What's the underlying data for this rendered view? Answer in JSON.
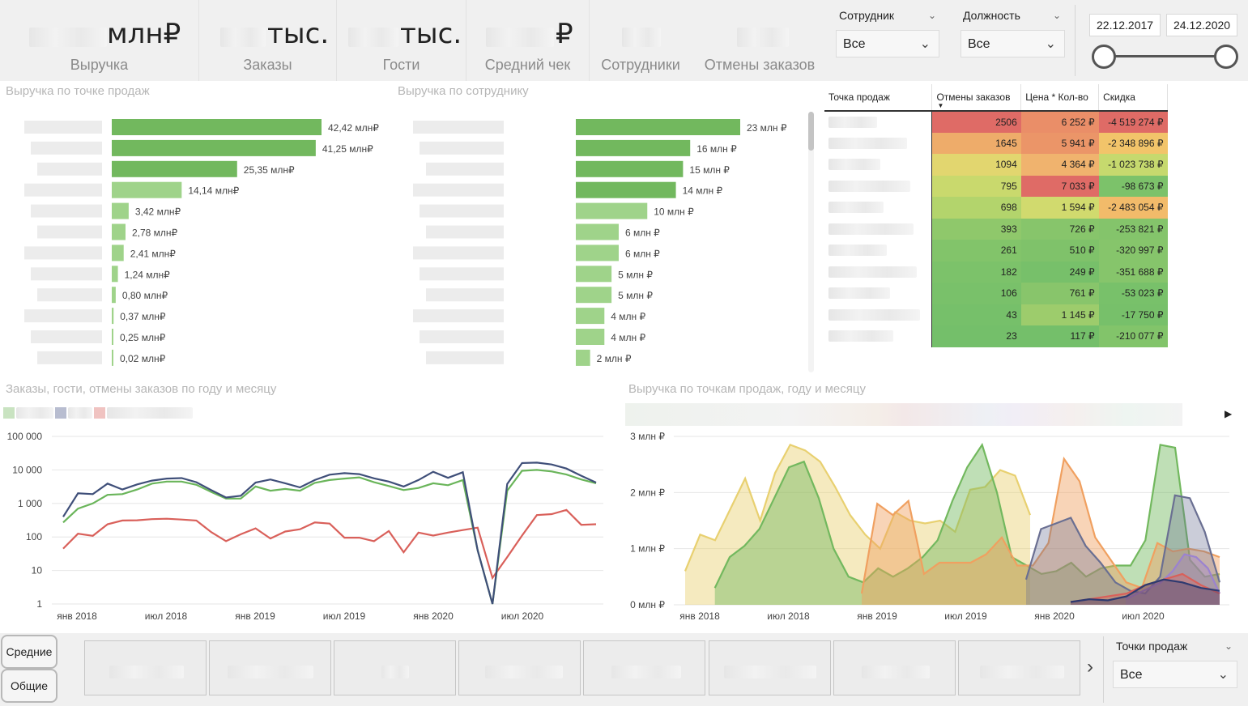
{
  "kpis": [
    {
      "unit": "млн₽",
      "label": "Выручка"
    },
    {
      "unit": "тыс.",
      "label": "Заказы"
    },
    {
      "unit": "тыс.",
      "label": "Гости"
    },
    {
      "unit": "₽",
      "label": "Средний чек"
    },
    {
      "unit": "",
      "label": "Сотрудники"
    },
    {
      "unit": "",
      "label": "Отмены заказов"
    }
  ],
  "filters": {
    "employee": {
      "title": "Сотрудник",
      "value": "Все"
    },
    "position": {
      "title": "Должность",
      "value": "Все"
    },
    "date_from": "22.12.2017",
    "date_to": "24.12.2020",
    "points": {
      "title": "Точки продаж",
      "value": "Все"
    }
  },
  "sections": {
    "revenue_by_point": "Выручка по точке продаж",
    "revenue_by_employee": "Выручка по сотруднику",
    "orders_chart": "Заказы, гости, отмены заказов по году и месяцу",
    "revenue_area_chart": "Выручка по точкам продаж, году и месяцу"
  },
  "buttons": {
    "averages": "Средние",
    "totals": "Общие"
  },
  "matrix": {
    "headers": [
      "Точка продаж",
      "Отмены заказов",
      "Цена * Кол-во",
      "Скидка"
    ],
    "rows": [
      {
        "cancel": "2506",
        "price": "6 252 ₽",
        "discount": "-4 519 274 ₽"
      },
      {
        "cancel": "1645",
        "price": "5 941 ₽",
        "discount": "-2 348 896 ₽"
      },
      {
        "cancel": "1094",
        "price": "4 364 ₽",
        "discount": "-1 023 738 ₽"
      },
      {
        "cancel": "795",
        "price": "7 033 ₽",
        "discount": "-98 673 ₽"
      },
      {
        "cancel": "698",
        "price": "1 594 ₽",
        "discount": "-2 483 054 ₽"
      },
      {
        "cancel": "393",
        "price": "726 ₽",
        "discount": "-253 821 ₽"
      },
      {
        "cancel": "261",
        "price": "510 ₽",
        "discount": "-320 997 ₽"
      },
      {
        "cancel": "182",
        "price": "249 ₽",
        "discount": "-351 688 ₽"
      },
      {
        "cancel": "106",
        "price": "761 ₽",
        "discount": "-53 023 ₽"
      },
      {
        "cancel": "43",
        "price": "1 145 ₽",
        "discount": "-17 750 ₽"
      },
      {
        "cancel": "23",
        "price": "117 ₽",
        "discount": "-210 077 ₽"
      }
    ]
  },
  "colors": {
    "bar_green": "#72b85e",
    "bar_light": "#9fd38a",
    "red": "#e06b66",
    "orange": "#f0a866",
    "yellow": "#e7d46e",
    "green": "#7ec46d"
  },
  "chart_data": [
    {
      "type": "bar",
      "title": "Выручка по точке продаж",
      "values": [
        42.42,
        41.25,
        25.35,
        14.14,
        3.42,
        2.78,
        2.41,
        1.24,
        0.8,
        0.37,
        0.25,
        0.02
      ],
      "labels": [
        "42,42 млн₽",
        "41,25 млн₽",
        "25,35 млн₽",
        "14,14 млн₽",
        "3,42 млн₽",
        "2,78 млн₽",
        "2,41 млн₽",
        "1,24 млн₽",
        "0,80 млн₽",
        "0,37 млн₽",
        "0,25 млн₽",
        "0,02 млн₽"
      ],
      "orientation": "horizontal"
    },
    {
      "type": "bar",
      "title": "Выручка по сотруднику",
      "values": [
        23,
        16,
        15,
        14,
        10,
        6,
        6,
        5,
        5,
        4,
        4,
        2
      ],
      "labels": [
        "23 млн ₽",
        "16 млн ₽",
        "15 млн ₽",
        "14 млн ₽",
        "10 млн ₽",
        "6 млн ₽",
        "6 млн ₽",
        "5 млн ₽",
        "5 млн ₽",
        "4 млн ₽",
        "4 млн ₽",
        "2 млн ₽"
      ],
      "orientation": "horizontal"
    },
    {
      "type": "line",
      "title": "Заказы, гости, отмены заказов по году и месяцу",
      "y_scale": "log",
      "ylim": [
        1,
        100000
      ],
      "y_ticks": [
        "100 000",
        "10 000",
        "1 000",
        "100",
        "10",
        "1"
      ],
      "x_ticks": [
        "янв 2018",
        "июл 2018",
        "янв 2019",
        "июл 2019",
        "янв 2020",
        "июл 2020"
      ],
      "series": [
        {
          "color": "#3f4f79",
          "values": [
            400,
            2000,
            1900,
            3900,
            2600,
            3700,
            4800,
            5500,
            5700,
            4300,
            2500,
            1500,
            1700,
            4200,
            5200,
            4000,
            3000,
            5000,
            7200,
            8000,
            7500,
            5600,
            4500,
            3200,
            5000,
            8800,
            5800,
            8500,
            40,
            1,
            3800,
            16000,
            16500,
            14500,
            11000,
            6700,
            4200
          ]
        },
        {
          "color": "#6ab55a",
          "values": [
            270,
            700,
            1000,
            1800,
            1900,
            2600,
            3900,
            4500,
            4500,
            3600,
            2200,
            1400,
            1400,
            3200,
            2400,
            2700,
            2400,
            4100,
            5000,
            5500,
            6000,
            4300,
            3300,
            2500,
            2900,
            4000,
            3500,
            5000,
            40,
            1,
            2400,
            9400,
            10000,
            9000,
            7300,
            5200,
            4000
          ]
        },
        {
          "color": "#d9605a",
          "values": [
            45,
            125,
            108,
            240,
            310,
            315,
            340,
            350,
            330,
            310,
            140,
            75,
            120,
            180,
            90,
            145,
            170,
            270,
            250,
            95,
            95,
            75,
            150,
            35,
            135,
            110,
            135,
            160,
            190,
            6,
            25,
            110,
            450,
            480,
            640,
            230,
            240
          ]
        }
      ]
    },
    {
      "type": "area",
      "title": "Выручка по точкам продаж, году и месяцу",
      "ylim": [
        0,
        3
      ],
      "y_ticks": [
        "3 млн ₽",
        "2 млн ₽",
        "1 млн ₽",
        "0 млн ₽"
      ],
      "x_ticks": [
        "янв 2018",
        "июл 2018",
        "янв 2019",
        "июл 2019",
        "янв 2020",
        "июл 2020"
      ],
      "series": [
        {
          "color": "#e8d070",
          "values": [
            0.6,
            1.25,
            1.15,
            1.7,
            2.25,
            1.5,
            2.35,
            2.85,
            2.75,
            2.55,
            2.1,
            1.6,
            1.25,
            1.0,
            1.65,
            1.5,
            1.45,
            1.5,
            1.3,
            2.05,
            2.1,
            2.4,
            2.3,
            1.6
          ]
        },
        {
          "color": "#72b85e",
          "values": [
            null,
            null,
            0.3,
            0.85,
            1.05,
            1.35,
            1.9,
            2.45,
            2.55,
            1.9,
            1.0,
            0.5,
            0.4,
            0.65,
            0.5,
            0.65,
            0.85,
            1.15,
            1.85,
            2.45,
            2.85,
            2.0,
            0.85,
            0.7,
            0.55,
            0.6,
            0.75,
            0.5,
            0.65,
            0.7,
            0.7,
            1.15,
            2.85,
            2.8,
            0.8,
            0.5,
            0.55
          ]
        },
        {
          "color": "#f0a060",
          "values": [
            0.2,
            1.8,
            1.6,
            1.85,
            0.55,
            0.75,
            0.75,
            0.75,
            0.9,
            1.2,
            0.7,
            0.7,
            1.1,
            2.6,
            2.2,
            1.2,
            0.8,
            0.4,
            0.3,
            1.1,
            0.95,
            1.0,
            0.95,
            0.85
          ]
        },
        {
          "color": "#6a6f92",
          "values": [
            0.45,
            1.35,
            1.45,
            1.55,
            1.05,
            0.75,
            0.4,
            0.25,
            0.2,
            0.5,
            1.95,
            1.9,
            1.3,
            0.4
          ]
        },
        {
          "color": "#9b82d0",
          "values": [
            0.1,
            0.2,
            0.3,
            0.4,
            0.6,
            0.9,
            0.85,
            0.65,
            0.2
          ]
        },
        {
          "color": "#d9605a",
          "values": [
            0.05,
            0.1,
            0.15,
            0.2,
            0.35,
            0.45,
            0.55,
            0.35,
            0.2
          ]
        },
        {
          "color": "#2e3a70",
          "values": [
            0.05,
            0.1,
            0.08,
            0.15,
            0.35,
            0.45,
            0.4,
            0.3,
            0.25
          ]
        }
      ]
    }
  ]
}
